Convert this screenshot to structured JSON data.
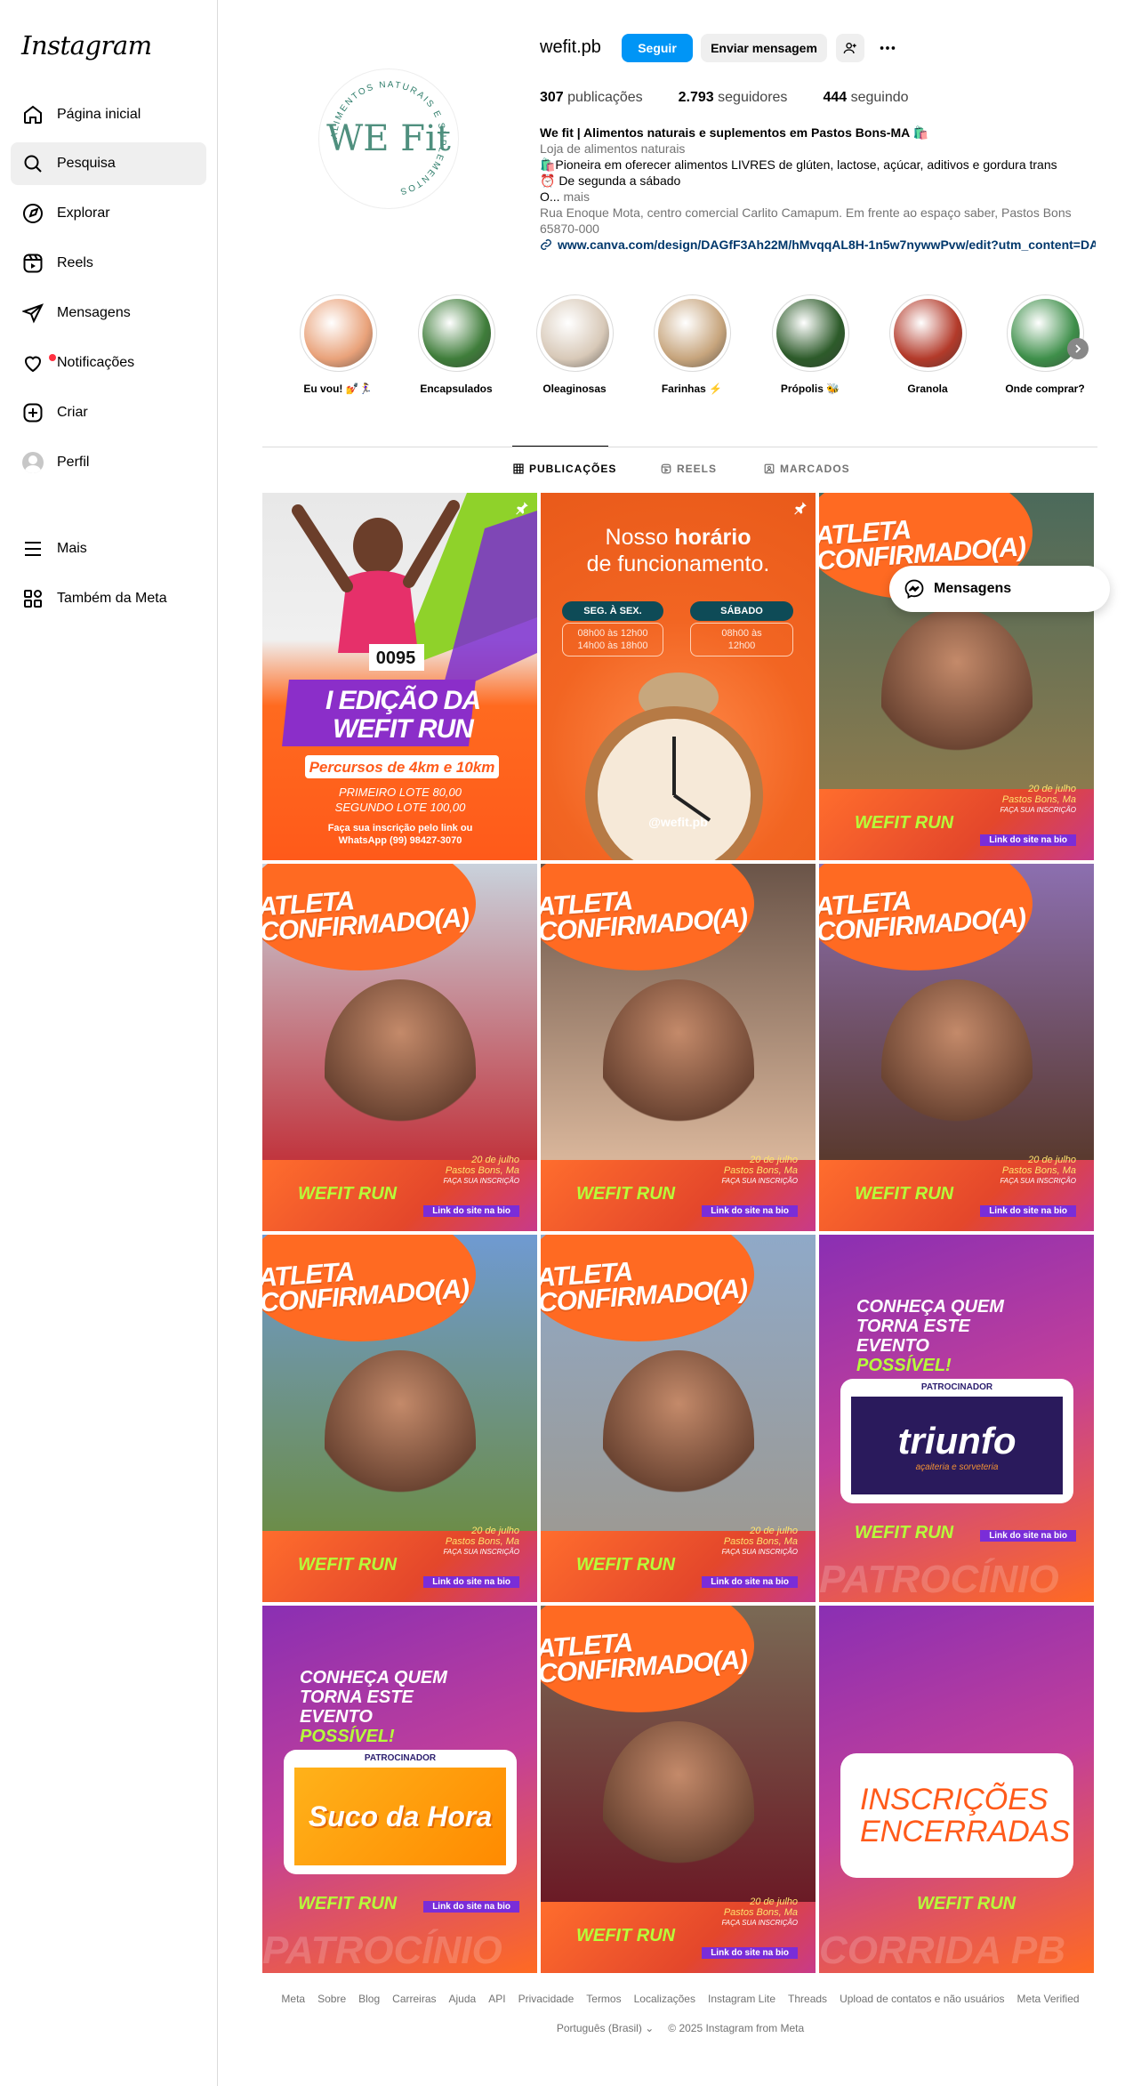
{
  "brand": "Instagram",
  "sidebar": {
    "items": [
      {
        "label": "Página inicial",
        "icon": "home-icon"
      },
      {
        "label": "Pesquisa",
        "icon": "search-icon"
      },
      {
        "label": "Explorar",
        "icon": "compass-icon"
      },
      {
        "label": "Reels",
        "icon": "reels-icon"
      },
      {
        "label": "Mensagens",
        "icon": "send-icon"
      },
      {
        "label": "Notificações",
        "icon": "heart-icon"
      },
      {
        "label": "Criar",
        "icon": "plus-square-icon"
      },
      {
        "label": "Perfil",
        "icon": "avatar-icon"
      }
    ],
    "more": {
      "label": "Mais",
      "icon": "menu-icon"
    },
    "meta": {
      "label": "Também da Meta",
      "icon": "meta-apps-icon"
    }
  },
  "profile": {
    "username": "wefit.pb",
    "logo_text": "WE Fit",
    "logo_ring_text": "ALIMENTOS NATURAIS E SUPLEMENTOS",
    "buttons": {
      "follow": "Seguir",
      "message": "Enviar mensagem"
    },
    "stats": [
      {
        "value": "307",
        "label": "publicações"
      },
      {
        "value": "2.793",
        "label": "seguidores"
      },
      {
        "value": "444",
        "label": "seguindo"
      }
    ],
    "bio": {
      "name": "We fit | Alimentos naturais e suplementos em Pastos Bons-MA 🛍️",
      "category": "Loja de alimentos naturais",
      "line1": "🛍️Pioneira em oferecer alimentos LIVRES de glúten, lactose, açúcar, aditivos e gordura trans",
      "line2": "⏰ De segunda a sábado",
      "line3": "O... ",
      "more": "mais",
      "address": "Rua Enoque Mota, centro comercial Carlito Camapum. Em frente ao espaço saber, Pastos Bons 65870-000",
      "link": "www.canva.com/design/DAGfF3Ah22M/hMvqqAL8H-1n5w7nywwPvw/edit?utm_content=DA..."
    }
  },
  "highlights": [
    {
      "label": "Eu vou! 💅🏃‍♀️",
      "color": "#e9a27a"
    },
    {
      "label": "Encapsulados",
      "color": "#3f7d3a"
    },
    {
      "label": "Oleaginosas",
      "color": "#d8c9b8"
    },
    {
      "label": "Farinhas ⚡",
      "color": "#c7a57d"
    },
    {
      "label": "Própolis 🐝",
      "color": "#2d5b2a"
    },
    {
      "label": "Granola",
      "color": "#b33a2a"
    },
    {
      "label": "Onde comprar?",
      "color": "#3e8f4a"
    }
  ],
  "tabs": [
    {
      "label": "PUBLICAÇÕES",
      "icon": "grid-icon"
    },
    {
      "label": "REELS",
      "icon": "reels-icon"
    },
    {
      "label": "MARCADOS",
      "icon": "tag-icon"
    }
  ],
  "posts": {
    "p1": {
      "title": "I EDIÇÃO DA WEFIT RUN",
      "sub": "Percursos de 4km e 10km",
      "lot1": "PRIMEIRO LOTE 80,00",
      "lot2": "SEGUNDO LOTE 100,00",
      "info": "Faça sua inscrição pelo link ou WhatsApp (99) 98427-3070",
      "bib": "0095"
    },
    "p2": {
      "title_a": "Nosso",
      "title_b": "horário",
      "title_c": "de funcionamento.",
      "d1": "SEG. À SEX.",
      "t1": "08h00 às 12h00\n14h00 às 18h00",
      "d2": "SÁBADO",
      "t2": "08h00 às\n12h00",
      "handle": "@wefit.pb"
    },
    "atleta": "ATLETA CONFIRMADO(A)",
    "run": "WEFIT RUN",
    "edition": "I EDIÇÃO DA",
    "date": "20 de julho",
    "place": "Pastos Bons, Ma",
    "inscr": "FAÇA SUA INSCRIÇÃO",
    "link": "Link do site na bio",
    "conheca": "CONHEÇA QUEM TORNA ESTE EVENTO",
    "possivel": "POSSÍVEL!",
    "patro": "PATROCINADOR",
    "triunfo": "triunfo",
    "triunfo_sub": "açaiteria e sorveteria",
    "suco": "Suco da Hora",
    "encerradas": "INSCRIÇÕES ENCERRADAS",
    "patrocinio_bg": "PATROCÍNIO",
    "corrida_bg": "CORRIDA PB"
  },
  "float_messages": "Mensagens",
  "footer": {
    "links": [
      "Meta",
      "Sobre",
      "Blog",
      "Carreiras",
      "Ajuda",
      "API",
      "Privacidade",
      "Termos",
      "Localizações",
      "Instagram Lite",
      "Threads",
      "Upload de contatos e não usuários",
      "Meta Verified"
    ],
    "language": "Português (Brasil)",
    "copyright": "© 2025 Instagram from Meta"
  }
}
